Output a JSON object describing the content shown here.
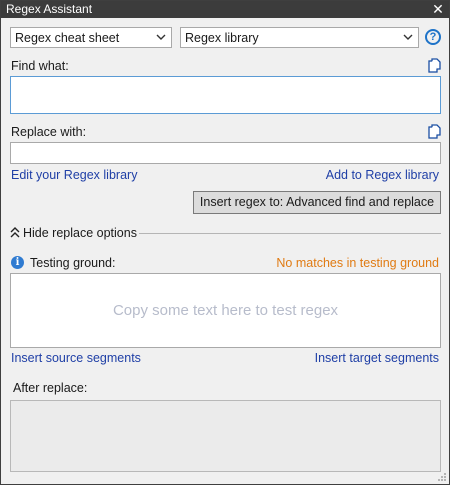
{
  "window": {
    "title": "Regex Assistant",
    "close_glyph": "✕"
  },
  "toolbar": {
    "cheat_sheet_value": "Regex cheat sheet",
    "library_value": "Regex library",
    "help_glyph": "?"
  },
  "find": {
    "label": "Find what:",
    "value": ""
  },
  "replace": {
    "label": "Replace with:",
    "value": ""
  },
  "links": {
    "edit_library": "Edit your Regex library",
    "add_library": "Add to Regex library",
    "insert_source": "Insert source segments",
    "insert_target": "Insert target segments"
  },
  "insert_button": {
    "label": "Insert regex to: Advanced find and replace"
  },
  "replace_options": {
    "toggle_label": "Hide replace options"
  },
  "testing": {
    "label": "Testing ground:",
    "status": "No matches in testing ground",
    "placeholder": "Copy some text here to test regex",
    "info_glyph": "i"
  },
  "after_replace": {
    "label": "After replace:",
    "value": ""
  },
  "colors": {
    "titlebar": "#3c3c3c",
    "link": "#1f3fa6",
    "status_warning": "#e07b13",
    "info": "#2f7bd1"
  },
  "icons": {
    "close": "close-icon",
    "dropdown": "chevron-down-icon",
    "help": "help-icon",
    "copy": "copy-icon",
    "collapse": "double-chevron-up-icon",
    "info": "info-icon",
    "resize": "resize-grip-icon"
  }
}
